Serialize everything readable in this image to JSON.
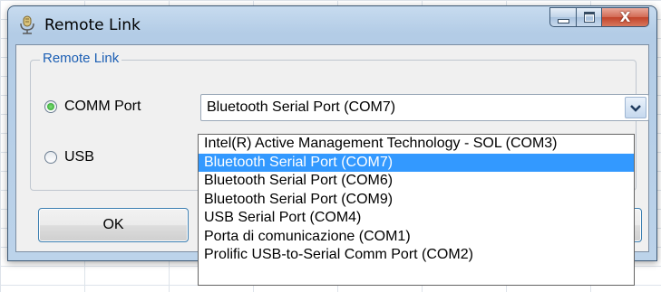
{
  "window": {
    "title": "Remote Link"
  },
  "caption": {
    "close_glyph": "X"
  },
  "group": {
    "label": "Remote Link"
  },
  "radios": [
    {
      "label": "COMM Port",
      "selected": true
    },
    {
      "label": "USB",
      "selected": false
    }
  ],
  "combo": {
    "value": "Bluetooth Serial Port (COM7)"
  },
  "buttons": {
    "ok_label": "OK",
    "cancel_label": ""
  },
  "dropdown": {
    "items": [
      "Intel(R) Active Management Technology - SOL (COM3)",
      "Bluetooth Serial Port (COM7)",
      "Bluetooth Serial Port (COM6)",
      "Bluetooth Serial Port (COM9)",
      "USB Serial Port (COM4)",
      "Porta di comunicazione (COM1)",
      "Prolific USB-to-Serial Comm Port (COM2)"
    ],
    "selected_index": 1
  },
  "colors": {
    "group_label": "#1c5fb4",
    "selection": "#3399ff",
    "close_button": "#c1432a"
  }
}
